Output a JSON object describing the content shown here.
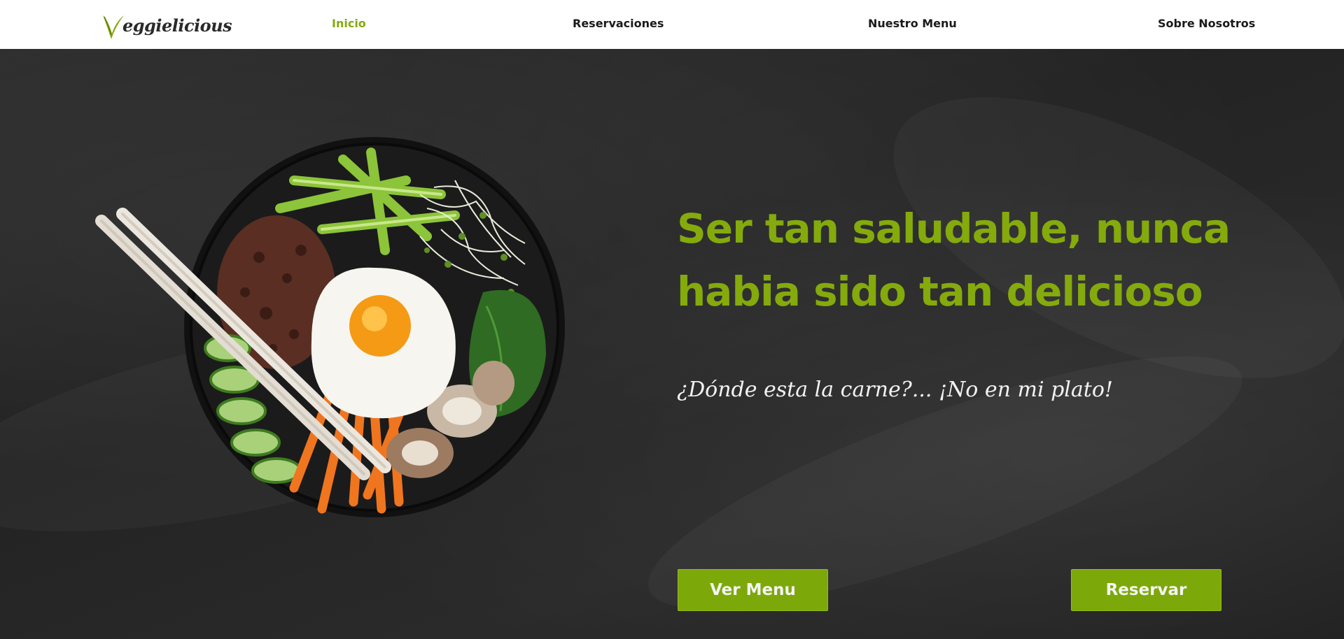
{
  "brand": {
    "name": "Veggielicious",
    "logo_letter": "V",
    "logo_rest": "eggielicious",
    "accent_color": "#84aa0c"
  },
  "nav": {
    "items": [
      {
        "label": "Inicio",
        "active": true
      },
      {
        "label": "Reservaciones",
        "active": false
      },
      {
        "label": "Nuestro Menu",
        "active": false
      },
      {
        "label": "Sobre Nosotros",
        "active": false
      }
    ]
  },
  "hero": {
    "headline_line1": "Ser tan saludable, nunca",
    "headline_line2": "habia sido tan delicioso",
    "tagline": "¿Dónde esta la carne?... ¡No en mi plato!",
    "image": "bibimbap-bowl-image",
    "buttons": {
      "ver_menu": "Ver Menu",
      "reservar": "Reservar"
    }
  },
  "colors": {
    "accent": "#84aa0c",
    "background": "#262626",
    "navbar": "#ffffff",
    "text_light": "#f2f2f2"
  }
}
